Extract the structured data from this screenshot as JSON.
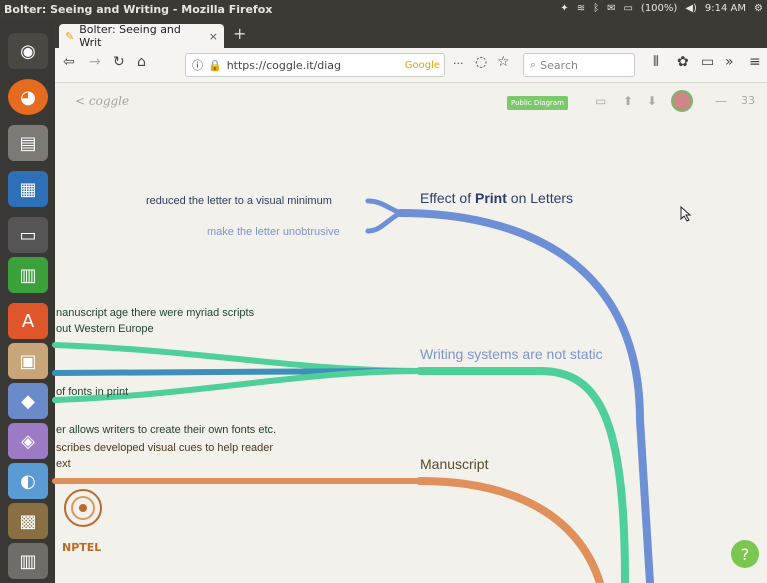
{
  "window": {
    "title": "Bolter: Seeing and Writing - Mozilla Firefox"
  },
  "system": {
    "battery": "(100%)",
    "time": "9:14 AM"
  },
  "tab": {
    "label": "Bolter: Seeing and Writ",
    "close": "×",
    "new": "+"
  },
  "nav": {
    "url": "https://coggle.it/diag",
    "url_prefix": "ⓘ",
    "search_engine": "Google",
    "more": "···",
    "search_placeholder": "Search",
    "overflow": "»"
  },
  "app": {
    "logo": "< coggle",
    "public_badge": "Public Diagram",
    "link_count": "33"
  },
  "diagram": {
    "nodes": {
      "effect_prefix": "Effect of ",
      "effect_bold": "Print",
      "effect_suffix": " on Letters",
      "writing_systems": "Writing systems are not static",
      "manuscript": "Manuscript"
    },
    "leaves": {
      "reduced": "reduced the letter to a visual minimum",
      "unobtrusive": "make the letter unobtrusive",
      "manuscript_age_1": "nanuscript age there were myriad scripts",
      "manuscript_age_2": "out Western Europe",
      "fonts": "of fonts in print",
      "create_fonts": "er allows writers to create their own fonts etc.",
      "cues": "scribes developed visual cues to help reader",
      "next": "ext"
    }
  },
  "watermark": {
    "text": "NPTEL"
  },
  "help": {
    "label": "?"
  },
  "colors": {
    "blue": "#6c8fd6",
    "green": "#4fcf9a",
    "orange": "#e0905a",
    "badge": "#7cc96b"
  }
}
